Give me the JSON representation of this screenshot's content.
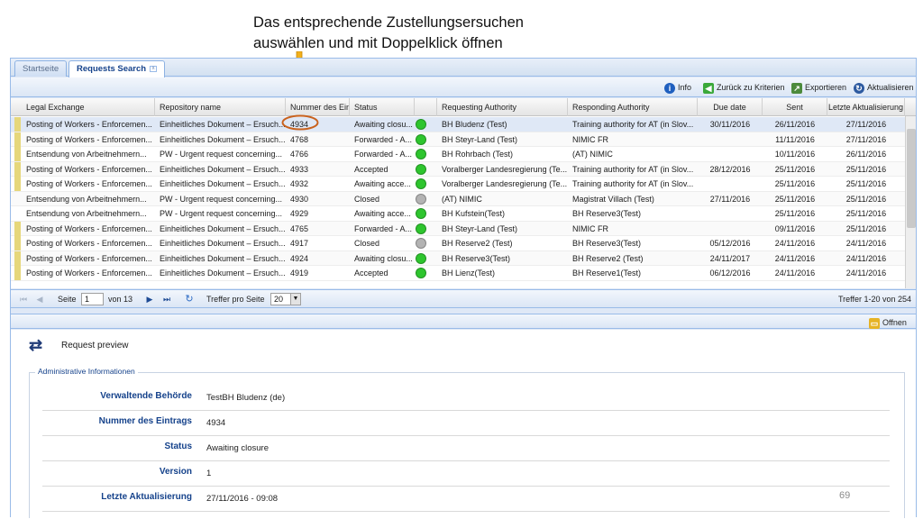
{
  "callout": {
    "line1": "Das entsprechende Zustellungsersuchen",
    "line2": "auswählen und mit Doppelklick öffnen"
  },
  "tabs": [
    {
      "label": "Startseite",
      "active": false
    },
    {
      "label": "Requests Search",
      "active": true,
      "close": "x"
    }
  ],
  "toolbar": {
    "info": "Info",
    "back": "Zurück zu Kriterien",
    "export": "Exportieren",
    "refresh": "Aktualisieren"
  },
  "columns": [
    "Legal Exchange",
    "Repository name",
    "Nummer des Eint",
    "Status",
    "",
    "Requesting Authority",
    "Responding Authority",
    "Due date",
    "Sent",
    "Letzte Aktualisierung"
  ],
  "status_colors": {
    "green": "#2ec52e",
    "grey": "#b3b3b3"
  },
  "rows": [
    {
      "legal": "Posting of Workers - Enforcemen...",
      "repo": "Einheitliches Dokument – Ersuch...",
      "num": "4934",
      "status": "Awaiting closu...",
      "light": "green",
      "req": "BH Bludenz (Test)",
      "resp": "Training authority for AT (in Slov...",
      "due": "30/11/2016",
      "sent": "26/11/2016",
      "updated": "27/11/2016",
      "marker": true
    },
    {
      "legal": "Posting of Workers - Enforcemen...",
      "repo": "Einheitliches Dokument – Ersuch...",
      "num": "4768",
      "status": "Forwarded - A...",
      "light": "green",
      "req": "BH Steyr-Land (Test)",
      "resp": "NIMIC FR",
      "due": "",
      "sent": "11/11/2016",
      "updated": "27/11/2016",
      "marker": true
    },
    {
      "legal": "Entsendung von Arbeitnehmern...",
      "repo": "PW - Urgent request concerning...",
      "num": "4766",
      "status": "Forwarded - A...",
      "light": "green",
      "req": "BH Rohrbach (Test)",
      "resp": "(AT) NIMIC",
      "due": "",
      "sent": "10/11/2016",
      "updated": "26/11/2016",
      "marker": true
    },
    {
      "legal": "Posting of Workers - Enforcemen...",
      "repo": "Einheitliches Dokument – Ersuch...",
      "num": "4933",
      "status": "Accepted",
      "light": "green",
      "req": "Voralberger Landesregierung (Te...",
      "resp": "Training authority for AT (in Slov...",
      "due": "28/12/2016",
      "sent": "25/11/2016",
      "updated": "25/11/2016",
      "marker": true
    },
    {
      "legal": "Posting of Workers - Enforcemen...",
      "repo": "Einheitliches Dokument – Ersuch...",
      "num": "4932",
      "status": "Awaiting acce...",
      "light": "green",
      "req": "Voralberger Landesregierung (Te...",
      "resp": "Training authority for AT (in Slov...",
      "due": "",
      "sent": "25/11/2016",
      "updated": "25/11/2016",
      "marker": true
    },
    {
      "legal": "Entsendung von Arbeitnehmern...",
      "repo": "PW - Urgent request concerning...",
      "num": "4930",
      "status": "Closed",
      "light": "grey",
      "req": "(AT) NIMIC",
      "resp": "Magistrat Villach (Test)",
      "due": "27/11/2016",
      "sent": "25/11/2016",
      "updated": "25/11/2016",
      "marker": false
    },
    {
      "legal": "Entsendung von Arbeitnehmern...",
      "repo": "PW - Urgent request concerning...",
      "num": "4929",
      "status": "Awaiting acce...",
      "light": "green",
      "req": "BH Kufstein(Test)",
      "resp": "BH Reserve3(Test)",
      "due": "",
      "sent": "25/11/2016",
      "updated": "25/11/2016",
      "marker": false
    },
    {
      "legal": "Posting of Workers - Enforcemen...",
      "repo": "Einheitliches Dokument – Ersuch...",
      "num": "4765",
      "status": "Forwarded - A...",
      "light": "green",
      "req": "BH Steyr-Land (Test)",
      "resp": "NIMIC FR",
      "due": "",
      "sent": "09/11/2016",
      "updated": "25/11/2016",
      "marker": true
    },
    {
      "legal": "Posting of Workers - Enforcemen...",
      "repo": "Einheitliches Dokument – Ersuch...",
      "num": "4917",
      "status": "Closed",
      "light": "grey",
      "req": "BH Reserve2 (Test)",
      "resp": "BH Reserve3(Test)",
      "due": "05/12/2016",
      "sent": "24/11/2016",
      "updated": "24/11/2016",
      "marker": true
    },
    {
      "legal": "Posting of Workers - Enforcemen...",
      "repo": "Einheitliches Dokument – Ersuch...",
      "num": "4924",
      "status": "Awaiting closu...",
      "light": "green",
      "req": "BH Reserve3(Test)",
      "resp": "BH Reserve2 (Test)",
      "due": "24/11/2017",
      "sent": "24/11/2016",
      "updated": "24/11/2016",
      "marker": true
    },
    {
      "legal": "Posting of Workers - Enforcemen...",
      "repo": "Einheitliches Dokument – Ersuch...",
      "num": "4919",
      "status": "Accepted",
      "light": "green",
      "req": "BH Lienz(Test)",
      "resp": "BH Reserve1(Test)",
      "due": "06/12/2016",
      "sent": "24/11/2016",
      "updated": "24/11/2016",
      "marker": true
    }
  ],
  "pager": {
    "page_label": "Seite",
    "page_value": "1",
    "of_label": "von 13",
    "per_page_label": "Treffer pro Seite",
    "per_page_value": "20",
    "hits": "Treffer 1-20 von 254"
  },
  "preview_toolbar": {
    "open": "Offnen"
  },
  "preview": {
    "title": "Request preview",
    "section": "Administrative Informationen",
    "fields": [
      {
        "label": "Verwaltende Behörde",
        "value": "TestBH Bludenz (de)"
      },
      {
        "label": "Nummer des Eintrags",
        "value": "4934"
      },
      {
        "label": "Status",
        "value": "Awaiting closure"
      },
      {
        "label": "Version",
        "value": "1"
      },
      {
        "label": "Letzte Aktualisierung",
        "value": "27/11/2016 - 09:08"
      }
    ]
  },
  "slide_number": "69"
}
